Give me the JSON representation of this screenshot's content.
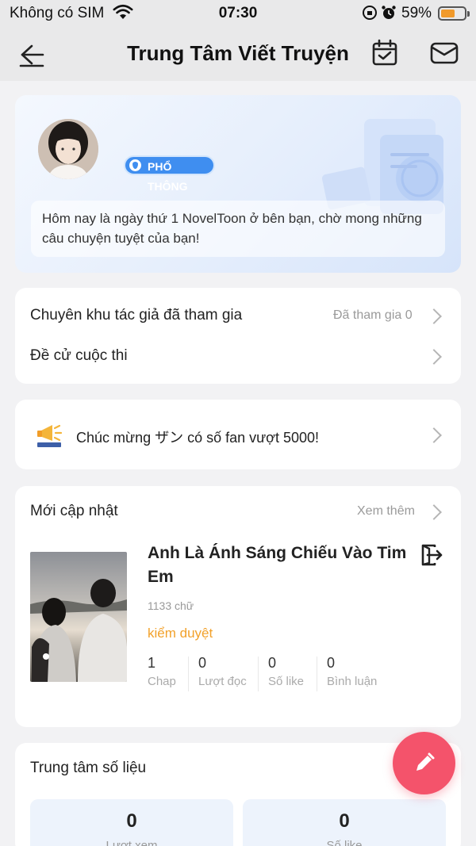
{
  "status_bar": {
    "carrier": "Không có SIM",
    "time": "07:30",
    "battery_pct": "59%",
    "battery_level": 0.59,
    "battery_color": "#f19a2b"
  },
  "nav": {
    "title": "Trung Tâm Viết Truyện",
    "icons": [
      "back-arrow-icon",
      "calendar-check-icon",
      "mail-icon"
    ]
  },
  "profile": {
    "badge": "PHỔ THÔNG",
    "badge_color": "#3f8ef0",
    "message": "Hôm nay là ngày thứ 1 NovelToon ở bên bạn, chờ mong những câu chuyện tuyệt của bạn!"
  },
  "menu": {
    "items": [
      {
        "label": "Chuyên khu tác giả đã tham gia",
        "value": "Đã tham gia 0"
      },
      {
        "label": "Đề cử cuộc thi",
        "value": ""
      }
    ]
  },
  "notice": {
    "text": "Chúc mừng ザン có số fan vượt 5000!"
  },
  "recent": {
    "header": "Mới cập nhật",
    "more": "Xem thêm",
    "book": {
      "title": "Anh Là Ánh Sáng Chiếu Vào Tim Em",
      "word_count": "1133 chữ",
      "status": "kiểm duyệt",
      "status_color": "#f2a12a",
      "stats": [
        {
          "value": "1",
          "label": "Chap"
        },
        {
          "value": "0",
          "label": "Lượt đọc"
        },
        {
          "value": "0",
          "label": "Số like"
        },
        {
          "value": "0",
          "label": "Bình luận"
        }
      ]
    }
  },
  "data_center": {
    "header": "Trung tâm số liệu",
    "metrics": [
      {
        "value": "0",
        "label": "Lượt xem"
      },
      {
        "value": "0",
        "label": "Số like"
      }
    ]
  },
  "fab": {
    "icon": "pencil-icon",
    "color": "#f4536b"
  }
}
